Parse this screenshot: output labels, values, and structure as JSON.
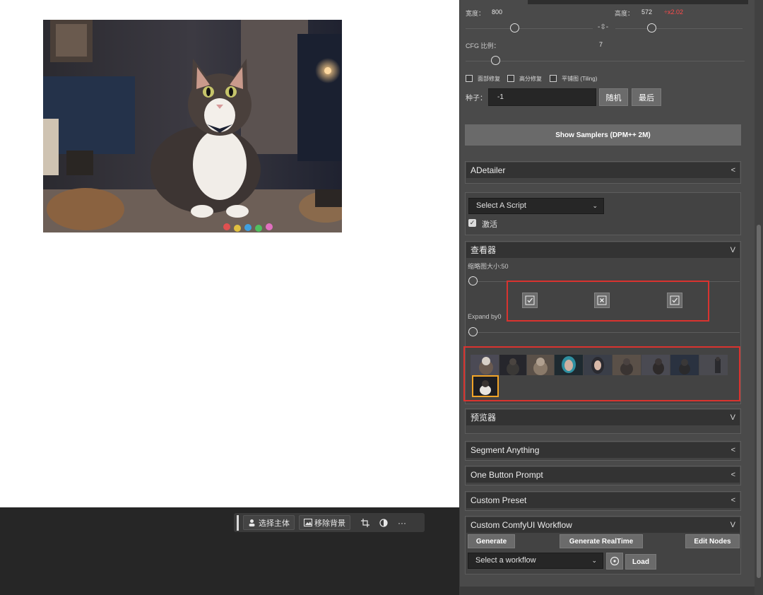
{
  "toolbar": {
    "select_subject": "选择主体",
    "remove_background": "移除背景",
    "crop_icon": "crop-icon",
    "mask_icon": "contrast-icon",
    "more": "···"
  },
  "params": {
    "width_label": "宽度：",
    "width_value": "800",
    "height_label": "高度：",
    "height_value": "572",
    "ratio_text": "÷x2.02",
    "cfg_label": "CFG 比例：",
    "cfg_value": "7",
    "cb_face_restore": "面部修复",
    "cb_hires_fix": "高分修复",
    "cb_tiling": "平铺图 (Tiling)",
    "seed_label": "种子：",
    "seed_value": "-1",
    "random_btn": "随机",
    "last_btn": "最后",
    "show_samplers": "Show Samplers (DPM++ 2M)"
  },
  "sections": {
    "adetailer": "ADetailer",
    "script_select": "Select A Script",
    "activate_label": "激活",
    "viewer": "查看器",
    "thumb_size_label": "缩略图大小:50",
    "expand_label": "Expand by0",
    "previewer": "预览器",
    "segment_anything": "Segment Anything",
    "one_button_prompt": "One Button Prompt",
    "custom_preset": "Custom Preset",
    "custom_comfy": "Custom ComfyUI Workflow",
    "generate": "Generate",
    "generate_realtime": "Generate RealTime",
    "edit_nodes": "Edit Nodes",
    "workflow_select": "Select a workflow",
    "load": "Load"
  },
  "carets": {
    "collapsed": "<",
    "expanded": "V",
    "dropdown": "⌄"
  },
  "colors": {
    "panel_bg": "#4a4a4a",
    "header_bg": "#333333",
    "highlight_red": "#d9332f",
    "selected_orange": "#f2a428"
  }
}
